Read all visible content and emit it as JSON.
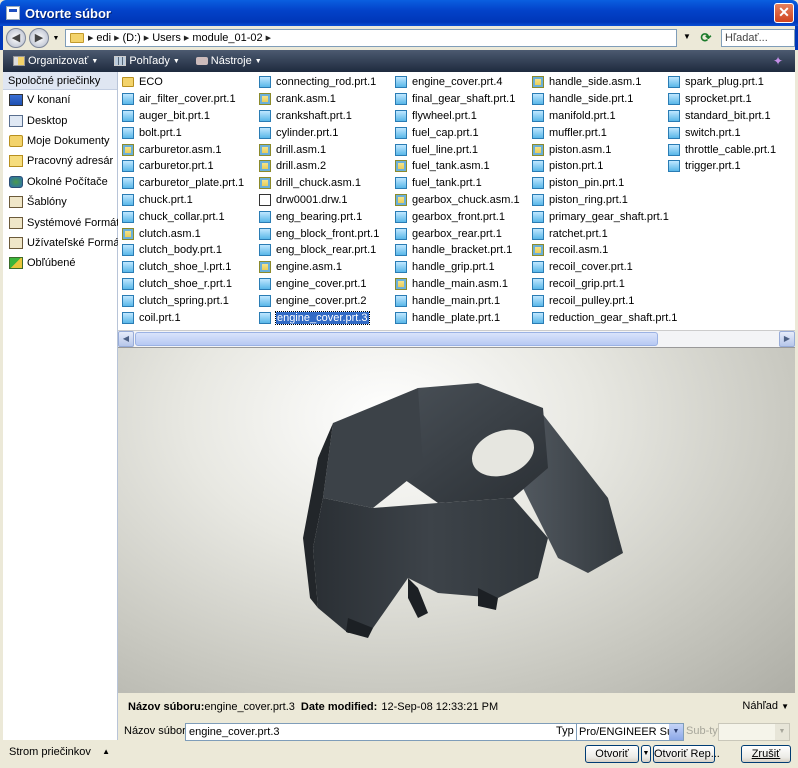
{
  "window": {
    "title": "Otvorte súbor"
  },
  "address": {
    "crumbs": [
      "edi",
      "(D:)",
      "Users",
      "module_01-02"
    ],
    "search_placeholder": "Hľadať..."
  },
  "toolbar": {
    "organize": "Organizovať",
    "views": "Pohľady",
    "tools": "Nástroje"
  },
  "sidebar": {
    "header": "Spoločné priečinky",
    "items": [
      {
        "label": "V konaní",
        "icon": "monitor-icon"
      },
      {
        "label": "Desktop",
        "icon": "desktop-icon"
      },
      {
        "label": "Moje Dokumenty",
        "icon": "my-documents-icon"
      },
      {
        "label": "Pracovný adresár",
        "icon": "working-directory-icon"
      },
      {
        "label": "Okolné Počítače",
        "icon": "network-icon"
      },
      {
        "label": "Šablóny",
        "icon": "templates-icon"
      },
      {
        "label": "Systémové Formáty",
        "icon": "system-formats-icon"
      },
      {
        "label": "Užívateľské Formáty",
        "icon": "user-formats-icon"
      },
      {
        "label": "Obľúbené",
        "icon": "favorites-icon"
      }
    ],
    "tree_label": "Strom priečinkov"
  },
  "files": {
    "selected": "engine_cover.prt.3",
    "columns": [
      [
        {
          "name": "ECO",
          "type": "folder"
        },
        {
          "name": "air_filter_cover.prt.1",
          "type": "prt"
        },
        {
          "name": "auger_bit.prt.1",
          "type": "prt"
        },
        {
          "name": "bolt.prt.1",
          "type": "prt"
        },
        {
          "name": "carburetor.asm.1",
          "type": "asm"
        },
        {
          "name": "carburetor.prt.1",
          "type": "prt"
        },
        {
          "name": "carburetor_plate.prt.1",
          "type": "prt"
        },
        {
          "name": "chuck.prt.1",
          "type": "prt"
        },
        {
          "name": "chuck_collar.prt.1",
          "type": "prt"
        },
        {
          "name": "clutch.asm.1",
          "type": "asm"
        },
        {
          "name": "clutch_body.prt.1",
          "type": "prt"
        },
        {
          "name": "clutch_shoe_l.prt.1",
          "type": "prt"
        },
        {
          "name": "clutch_shoe_r.prt.1",
          "type": "prt"
        },
        {
          "name": "clutch_spring.prt.1",
          "type": "prt"
        },
        {
          "name": "coil.prt.1",
          "type": "prt"
        }
      ],
      [
        {
          "name": "connecting_rod.prt.1",
          "type": "prt"
        },
        {
          "name": "crank.asm.1",
          "type": "asm"
        },
        {
          "name": "crankshaft.prt.1",
          "type": "prt"
        },
        {
          "name": "cylinder.prt.1",
          "type": "prt"
        },
        {
          "name": "drill.asm.1",
          "type": "asm"
        },
        {
          "name": "drill.asm.2",
          "type": "asm"
        },
        {
          "name": "drill_chuck.asm.1",
          "type": "asm"
        },
        {
          "name": "drw0001.drw.1",
          "type": "drw"
        },
        {
          "name": "eng_bearing.prt.1",
          "type": "prt"
        },
        {
          "name": "eng_block_front.prt.1",
          "type": "prt"
        },
        {
          "name": "eng_block_rear.prt.1",
          "type": "prt"
        },
        {
          "name": "engine.asm.1",
          "type": "asm"
        },
        {
          "name": "engine_cover.prt.1",
          "type": "prt"
        },
        {
          "name": "engine_cover.prt.2",
          "type": "prt"
        },
        {
          "name": "engine_cover.prt.3",
          "type": "prt"
        }
      ],
      [
        {
          "name": "engine_cover.prt.4",
          "type": "prt"
        },
        {
          "name": "final_gear_shaft.prt.1",
          "type": "prt"
        },
        {
          "name": "flywheel.prt.1",
          "type": "prt"
        },
        {
          "name": "fuel_cap.prt.1",
          "type": "prt"
        },
        {
          "name": "fuel_line.prt.1",
          "type": "prt"
        },
        {
          "name": "fuel_tank.asm.1",
          "type": "asm"
        },
        {
          "name": "fuel_tank.prt.1",
          "type": "prt"
        },
        {
          "name": "gearbox_chuck.asm.1",
          "type": "asm"
        },
        {
          "name": "gearbox_front.prt.1",
          "type": "prt"
        },
        {
          "name": "gearbox_rear.prt.1",
          "type": "prt"
        },
        {
          "name": "handle_bracket.prt.1",
          "type": "prt"
        },
        {
          "name": "handle_grip.prt.1",
          "type": "prt"
        },
        {
          "name": "handle_main.asm.1",
          "type": "asm"
        },
        {
          "name": "handle_main.prt.1",
          "type": "prt"
        },
        {
          "name": "handle_plate.prt.1",
          "type": "prt"
        }
      ],
      [
        {
          "name": "handle_side.asm.1",
          "type": "asm"
        },
        {
          "name": "handle_side.prt.1",
          "type": "prt"
        },
        {
          "name": "manifold.prt.1",
          "type": "prt"
        },
        {
          "name": "muffler.prt.1",
          "type": "prt"
        },
        {
          "name": "piston.asm.1",
          "type": "asm"
        },
        {
          "name": "piston.prt.1",
          "type": "prt"
        },
        {
          "name": "piston_pin.prt.1",
          "type": "prt"
        },
        {
          "name": "piston_ring.prt.1",
          "type": "prt"
        },
        {
          "name": "primary_gear_shaft.prt.1",
          "type": "prt"
        },
        {
          "name": "ratchet.prt.1",
          "type": "prt"
        },
        {
          "name": "recoil.asm.1",
          "type": "asm"
        },
        {
          "name": "recoil_cover.prt.1",
          "type": "prt"
        },
        {
          "name": "recoil_grip.prt.1",
          "type": "prt"
        },
        {
          "name": "recoil_pulley.prt.1",
          "type": "prt"
        },
        {
          "name": "reduction_gear_shaft.prt.1",
          "type": "prt"
        }
      ],
      [
        {
          "name": "spark_plug.prt.1",
          "type": "prt"
        },
        {
          "name": "sprocket.prt.1",
          "type": "prt"
        },
        {
          "name": "standard_bit.prt.1",
          "type": "prt"
        },
        {
          "name": "switch.prt.1",
          "type": "prt"
        },
        {
          "name": "throttle_cable.prt.1",
          "type": "prt"
        },
        {
          "name": "trigger.prt.1",
          "type": "prt"
        }
      ]
    ]
  },
  "info": {
    "filename_label": "Názov súboru:",
    "filename_value": "engine_cover.prt.3",
    "modified_label": "Date modified:",
    "modified_value": "12-Sep-08 12:33:21 PM",
    "preview_label": "Náhľad"
  },
  "form": {
    "filename_label": "Názov súboru:",
    "filename_value": "engine_cover.prt.3",
    "type_label": "Typ",
    "type_value": "Pro/ENGINEER Súbory",
    "subtype_label": "Sub-typ",
    "open_button": "Otvoriť",
    "open_rep_button": "Otvoriť Rep...",
    "cancel_button": "Zrušiť"
  }
}
